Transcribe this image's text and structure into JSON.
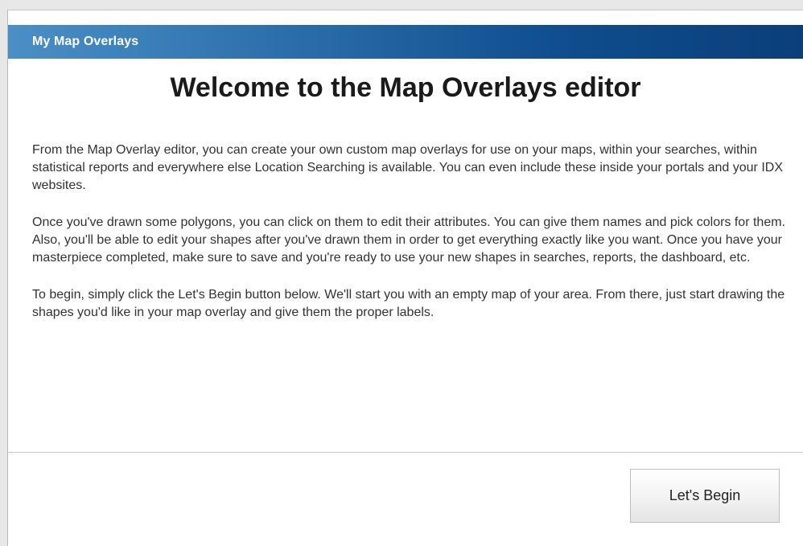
{
  "header": {
    "title": "My Map Overlays"
  },
  "main": {
    "heading": "Welcome to the Map Overlays editor",
    "paragraphs": [
      "From the Map Overlay editor, you can create your own custom map overlays for use on your maps, within your searches, within statistical reports and everywhere else Location Searching is available. You can even include these inside your portals and your IDX websites.",
      "Once you've drawn some polygons, you can click on them to edit their attributes. You can give them names and pick colors for them. Also, you'll be able to edit your shapes after you've drawn them in order to get everything exactly like you want. Once you have your masterpiece completed, make sure to save and you're ready to use your new shapes in searches, reports, the dashboard, etc.",
      "To begin, simply click the Let's Begin button below. We'll start you with an empty map of your area. From there, just start drawing the shapes you'd like in your map overlay and give them the proper labels."
    ]
  },
  "footer": {
    "begin_label": "Let's Begin"
  },
  "colors": {
    "header_gradient_start": "#4a90c6",
    "header_gradient_end": "#0a3f7a",
    "text": "#333333",
    "heading": "#1a1a1a"
  }
}
